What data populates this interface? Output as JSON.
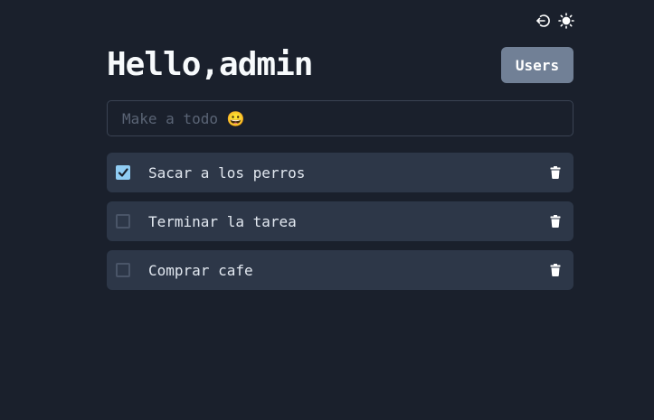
{
  "header": {
    "title": "Hello,admin",
    "users_label": "Users"
  },
  "topbar": {
    "logout_icon": "logout-icon",
    "theme_icon": "sun-icon"
  },
  "input": {
    "placeholder": "Make a todo 😀",
    "value": ""
  },
  "todos": [
    {
      "text": "Sacar a los perros",
      "checked": true
    },
    {
      "text": "Terminar la tarea",
      "checked": false
    },
    {
      "text": "Comprar cafe",
      "checked": false
    }
  ],
  "colors": {
    "background": "#1a202c",
    "card": "#2d3748",
    "accent": "#90cdf4",
    "button": "#718096"
  }
}
